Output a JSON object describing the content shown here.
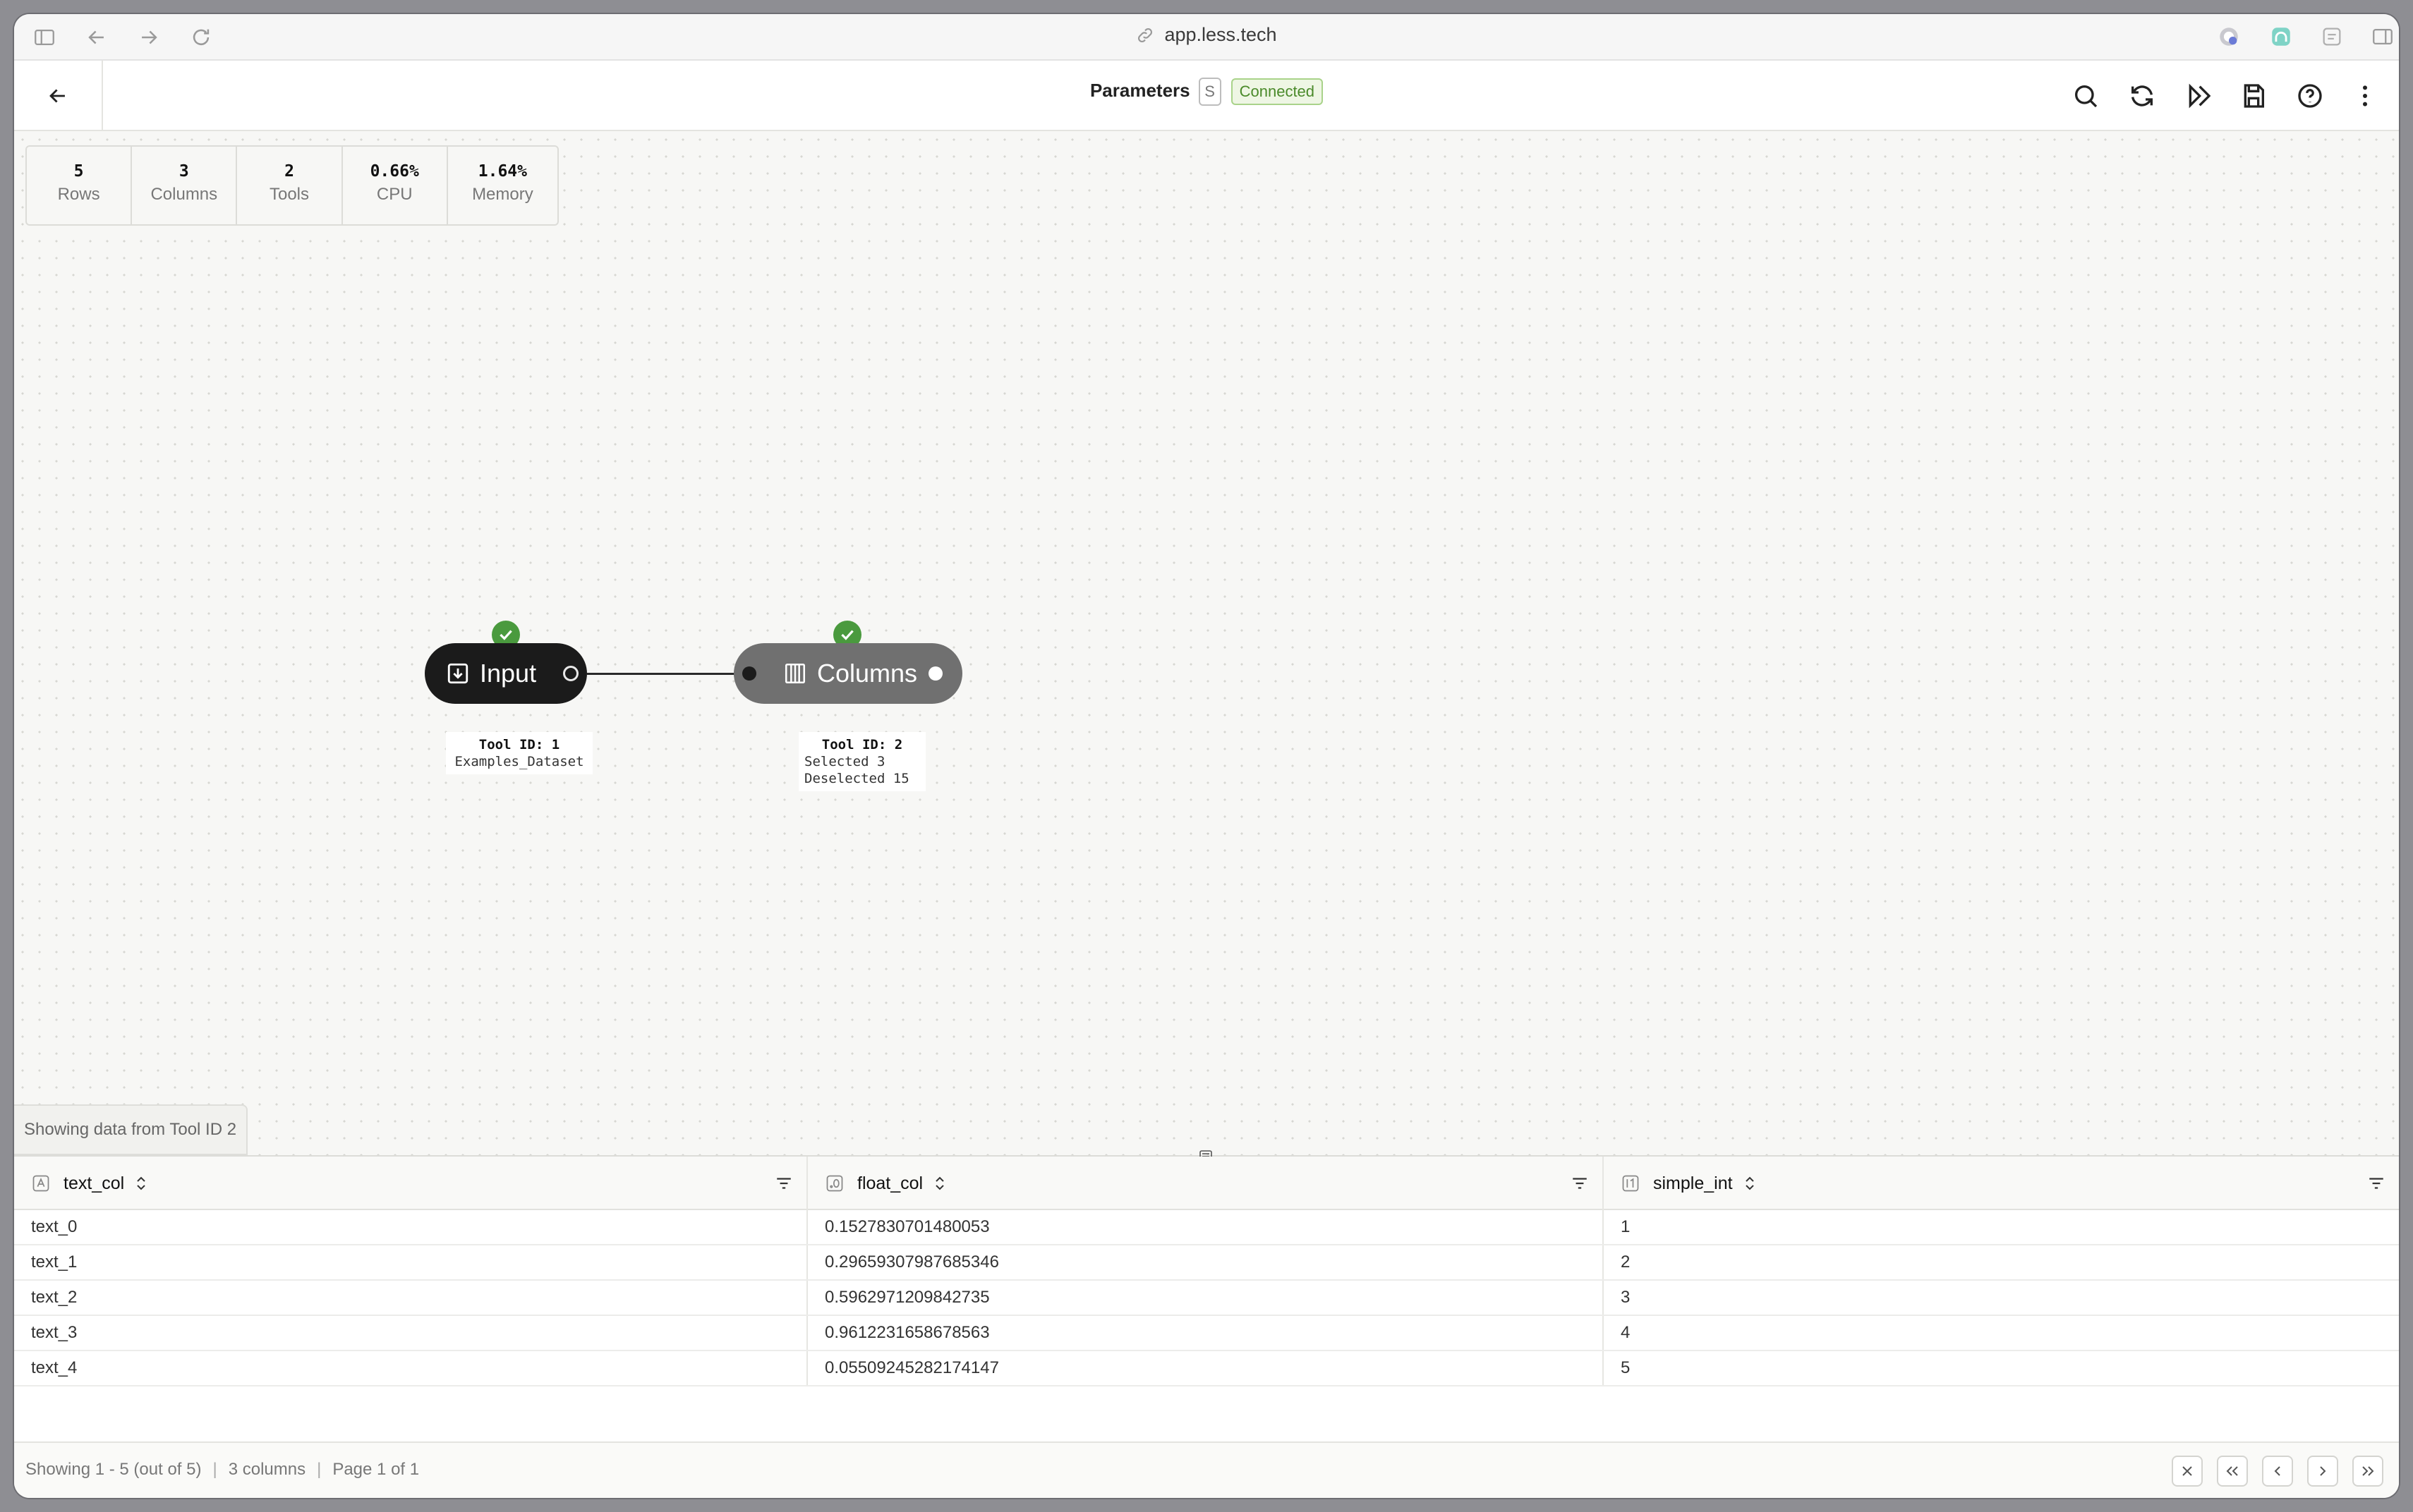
{
  "browser": {
    "url": "app.less.tech",
    "icons": [
      "sidebar-toggle-icon",
      "back-arrow-icon",
      "forward-arrow-icon",
      "reload-icon",
      "link-icon",
      "split-view-icon"
    ]
  },
  "header": {
    "title": "Parameters",
    "shortcut_badge": "S",
    "status": "Connected",
    "toolbar_icons": [
      "search-icon",
      "refresh-icon",
      "run-icon",
      "save-icon",
      "help-icon",
      "more-icon"
    ]
  },
  "stats": [
    {
      "value": "5",
      "label": "Rows"
    },
    {
      "value": "3",
      "label": "Columns"
    },
    {
      "value": "2",
      "label": "Tools"
    },
    {
      "value": "0.66%",
      "label": "CPU"
    },
    {
      "value": "1.64%",
      "label": "Memory"
    }
  ],
  "nodes": [
    {
      "label": "Input",
      "icon": "import-icon",
      "tool_id": "Tool ID: 1",
      "details": [
        "Examples_Dataset"
      ],
      "status": "success"
    },
    {
      "label": "Columns",
      "icon": "columns-icon",
      "tool_id": "Tool ID: 2",
      "details": [
        "Selected 3",
        "Deselected 15"
      ],
      "status": "success"
    }
  ],
  "canvas": {
    "showing_tag": "Showing data from Tool ID 2"
  },
  "table": {
    "columns": [
      {
        "name": "text_col",
        "type_icon": "text-type-icon"
      },
      {
        "name": "float_col",
        "type_icon": "float-type-icon"
      },
      {
        "name": "simple_int",
        "type_icon": "int-type-icon"
      }
    ],
    "rows": [
      [
        "text_0",
        "0.1527830701480053",
        "1"
      ],
      [
        "text_1",
        "0.29659307987685346",
        "2"
      ],
      [
        "text_2",
        "0.5962971209842735",
        "3"
      ],
      [
        "text_3",
        "0.9612231658678563",
        "4"
      ],
      [
        "text_4",
        "0.05509245282174147",
        "5"
      ]
    ]
  },
  "footer": {
    "showing": "Showing 1 - 5 (out of 5)",
    "columns": "3 columns",
    "page": "Page 1 of 1"
  },
  "colors": {
    "success": "#4a9a3e",
    "connected_text": "#4a8a2a",
    "input_node": "#1b1b1b",
    "columns_node": "#707070"
  }
}
